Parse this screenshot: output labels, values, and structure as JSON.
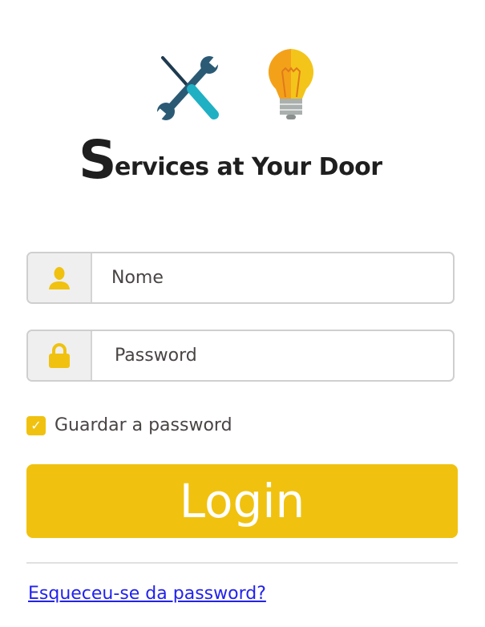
{
  "logo": {
    "text_initial": "S",
    "text_rest": "ervices at Your Door"
  },
  "form": {
    "username": {
      "placeholder": "Nome",
      "value": "",
      "icon": "user-icon"
    },
    "password": {
      "placeholder": "Password",
      "value": "",
      "icon": "lock-icon"
    },
    "remember": {
      "label": "Guardar a password",
      "checked": true
    },
    "login_label": "Login",
    "forgot_label": "Esqueceu-se da password?"
  },
  "colors": {
    "accent": "#f0c20f",
    "link": "#2222ee",
    "text": "#4a4444"
  }
}
